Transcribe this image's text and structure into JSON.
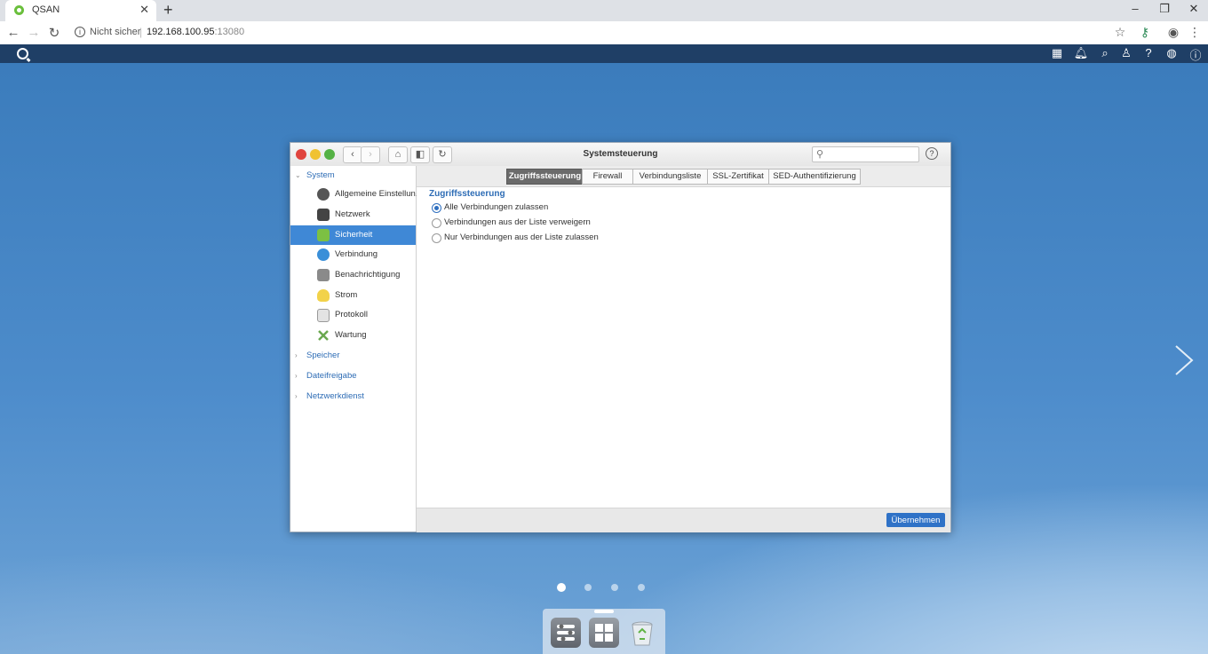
{
  "browser": {
    "tab_title": "QSAN",
    "security_label": "Nicht sicher",
    "url_host": "192.168.100.95",
    "url_port": ":13080"
  },
  "window": {
    "title": "Systemsteuerung"
  },
  "sidebar": {
    "groups": [
      {
        "label": "System"
      },
      {
        "label": "Speicher"
      },
      {
        "label": "Dateifreigabe"
      },
      {
        "label": "Netzwerkdienst"
      }
    ],
    "items": [
      {
        "label": "Allgemeine Einstellun...",
        "color": "#555555"
      },
      {
        "label": "Netzwerk",
        "color": "#444444"
      },
      {
        "label": "Sicherheit",
        "color": "#7cc043"
      },
      {
        "label": "Verbindung",
        "color": "#3a8fd8"
      },
      {
        "label": "Benachrichtigung",
        "color": "#8a8a8a"
      },
      {
        "label": "Strom",
        "color": "#f2d24a"
      },
      {
        "label": "Protokoll",
        "color": "#9a9a9a"
      },
      {
        "label": "Wartung",
        "color": "#6aa84f"
      }
    ],
    "active_item": "Sicherheit"
  },
  "tabs": [
    {
      "label": "Zugriffssteuerung",
      "active": true
    },
    {
      "label": "Firewall",
      "active": false
    },
    {
      "label": "Verbindungsliste",
      "active": false
    },
    {
      "label": "SSL-Zertifikat",
      "active": false
    },
    {
      "label": "SED-Authentifizierung",
      "active": false
    }
  ],
  "section": {
    "title": "Zugriffssteuerung",
    "options": [
      {
        "label": "Alle Verbindungen zulassen",
        "checked": true
      },
      {
        "label": "Verbindungen aus der Liste verweigern",
        "checked": false
      },
      {
        "label": "Nur Verbindungen aus der Liste zulassen",
        "checked": false
      }
    ]
  },
  "footer": {
    "apply_label": "Übernehmen"
  },
  "desktop": {
    "page_dots": 4,
    "active_page": 1
  },
  "colors": {
    "accent": "#3f88d6",
    "apply_button": "#2f72c7",
    "desktop_bar": "#1f3f66"
  }
}
